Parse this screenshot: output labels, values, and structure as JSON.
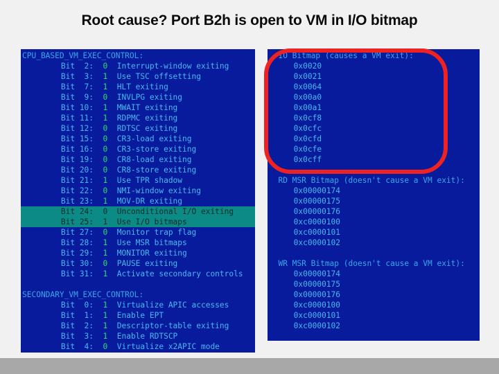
{
  "slide": {
    "title": "Root cause? Port B2h is open to VM in I/O bitmap",
    "accent_red": "#ee2222",
    "terminal_bg": "#071b9c",
    "terminal_fg": "#49b8ef",
    "highlight_bg": "#0b8a86",
    "value_color": "#2fdb6f",
    "footer_color": "#a8a8a8"
  },
  "left_panel": {
    "sections": [
      {
        "header": "CPU_BASED_VM_EXEC_CONTROL:",
        "rows": [
          {
            "bit": "Bit  2:",
            "value": "0",
            "desc": "Interrupt-window exiting",
            "highlight": false
          },
          {
            "bit": "Bit  3:",
            "value": "1",
            "desc": "Use TSC offsetting",
            "highlight": false
          },
          {
            "bit": "Bit  7:",
            "value": "1",
            "desc": "HLT exiting",
            "highlight": false
          },
          {
            "bit": "Bit  9:",
            "value": "0",
            "desc": "INVLPG exiting",
            "highlight": false
          },
          {
            "bit": "Bit 10:",
            "value": "1",
            "desc": "MWAIT exiting",
            "highlight": false
          },
          {
            "bit": "Bit 11:",
            "value": "1",
            "desc": "RDPMC exiting",
            "highlight": false
          },
          {
            "bit": "Bit 12:",
            "value": "0",
            "desc": "RDTSC exiting",
            "highlight": false
          },
          {
            "bit": "Bit 15:",
            "value": "0",
            "desc": "CR3-load exiting",
            "highlight": false
          },
          {
            "bit": "Bit 16:",
            "value": "0",
            "desc": "CR3-store exiting",
            "highlight": false
          },
          {
            "bit": "Bit 19:",
            "value": "0",
            "desc": "CR8-load exiting",
            "highlight": false
          },
          {
            "bit": "Bit 20:",
            "value": "0",
            "desc": "CR8-store exiting",
            "highlight": false
          },
          {
            "bit": "Bit 21:",
            "value": "1",
            "desc": "Use TPR shadow",
            "highlight": false
          },
          {
            "bit": "Bit 22:",
            "value": "0",
            "desc": "NMI-window exiting",
            "highlight": false
          },
          {
            "bit": "Bit 23:",
            "value": "1",
            "desc": "MOV-DR exiting",
            "highlight": false
          },
          {
            "bit": "Bit 24:",
            "value": "0",
            "desc": "Unconditional I/O exiting",
            "highlight": true
          },
          {
            "bit": "Bit 25:",
            "value": "1",
            "desc": "Use I/O bitmaps",
            "highlight": true
          },
          {
            "bit": "Bit 27:",
            "value": "0",
            "desc": "Monitor trap flag",
            "highlight": false
          },
          {
            "bit": "Bit 28:",
            "value": "1",
            "desc": "Use MSR bitmaps",
            "highlight": false
          },
          {
            "bit": "Bit 29:",
            "value": "1",
            "desc": "MONITOR exiting",
            "highlight": false
          },
          {
            "bit": "Bit 30:",
            "value": "0",
            "desc": "PAUSE exiting",
            "highlight": false
          },
          {
            "bit": "Bit 31:",
            "value": "1",
            "desc": "Activate secondary controls",
            "highlight": false
          }
        ]
      },
      {
        "header": "SECONDARY_VM_EXEC_CONTROL:",
        "rows": [
          {
            "bit": "Bit  0:",
            "value": "1",
            "desc": "Virtualize APIC accesses",
            "highlight": false
          },
          {
            "bit": "Bit  1:",
            "value": "1",
            "desc": "Enable EPT",
            "highlight": false
          },
          {
            "bit": "Bit  2:",
            "value": "1",
            "desc": "Descriptor-table exiting",
            "highlight": false
          },
          {
            "bit": "Bit  3:",
            "value": "1",
            "desc": "Enable RDTSCP",
            "highlight": false
          },
          {
            "bit": "Bit  4:",
            "value": "0",
            "desc": "Virtualize x2APIC mode",
            "highlight": false
          }
        ]
      }
    ]
  },
  "right_panel": {
    "sections": [
      {
        "header": "IO Bitmap (causes a VM exit):",
        "addresses": [
          "0x0020",
          "0x0021",
          "0x0064",
          "0x00a0",
          "0x00a1",
          "0x0cf8",
          "0x0cfc",
          "0x0cfd",
          "0x0cfe",
          "0x0cff"
        ]
      },
      {
        "header": "RD MSR Bitmap (doesn't cause a VM exit):",
        "addresses": [
          "0x00000174",
          "0x00000175",
          "0x00000176",
          "0xc0000100",
          "0xc0000101",
          "0xc0000102"
        ]
      },
      {
        "header": "WR MSR Bitmap (doesn't cause a VM exit):",
        "addresses": [
          "0x00000174",
          "0x00000175",
          "0x00000176",
          "0xc0000100",
          "0xc0000101",
          "0xc0000102"
        ]
      }
    ]
  }
}
